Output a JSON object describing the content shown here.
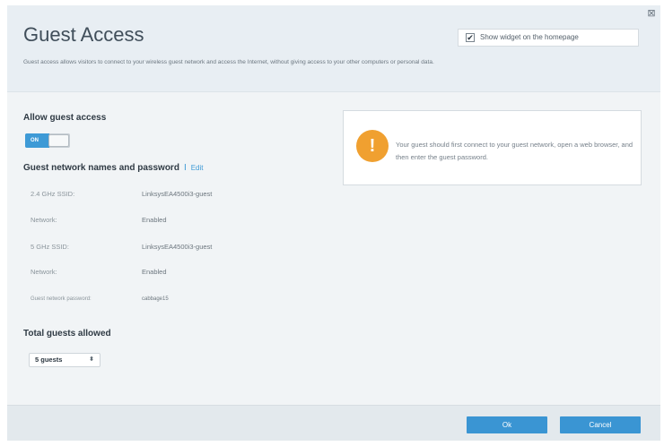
{
  "header": {
    "title": "Guest Access",
    "description": "Guest access allows visitors to connect to your wireless guest network and access the Internet, without giving access to your other computers or personal data.",
    "widget_label": "Show widget on the homepage",
    "widget_checked": true
  },
  "allow_guest_access": {
    "label": "Allow guest access",
    "toggle_label": "ON",
    "enabled": true
  },
  "network_names": {
    "heading": "Guest network names and password",
    "separator": "I",
    "edit_label": "Edit",
    "rows": [
      {
        "label": "2.4 GHz SSID:",
        "value": "LinksysEA4500i3-guest"
      },
      {
        "label": "Network:",
        "value": "Enabled"
      },
      {
        "label": "5 GHz SSID:",
        "value": "LinksysEA4500i3-guest"
      },
      {
        "label": "Network:",
        "value": "Enabled"
      },
      {
        "label": "Guest network password:",
        "value": "cabbage15"
      }
    ]
  },
  "total_guests": {
    "label": "Total guests allowed",
    "selected": "5 guests"
  },
  "info": {
    "icon": "warning-icon",
    "icon_glyph": "!",
    "text": "Your guest should first connect to your guest network, open a web browser, and then enter the guest password."
  },
  "footer": {
    "ok_label": "Ok",
    "cancel_label": "Cancel"
  },
  "colors": {
    "accent": "#3a95d3",
    "warning": "#f0a030"
  }
}
